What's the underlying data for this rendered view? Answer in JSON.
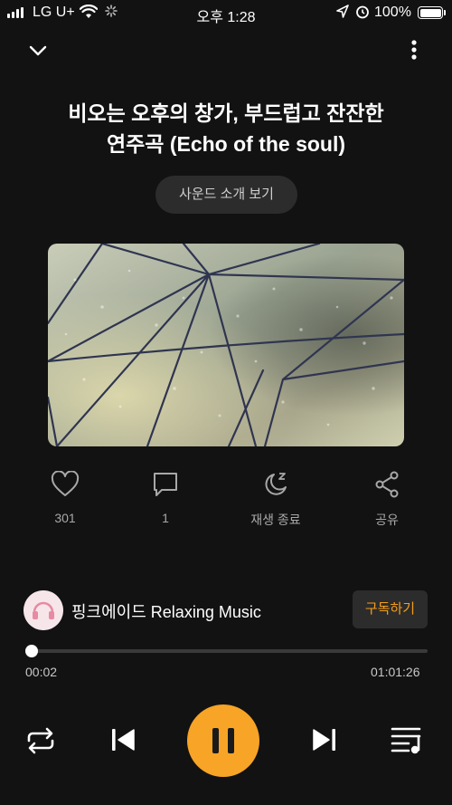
{
  "status_bar": {
    "carrier": "LG U+",
    "time": "오후 1:28",
    "battery_percent": "100%"
  },
  "header": {
    "collapse_icon": "chevron-down-icon",
    "more_icon": "more-vertical-icon"
  },
  "track": {
    "title": "비오는 오후의 창가, 부드럽고 잔잔한\n연주곡 (Echo of the soul)",
    "intro_button": "사운드 소개 보기",
    "artwork": "rainy-umbrella-image"
  },
  "actions": [
    {
      "icon": "heart-icon",
      "label": "301"
    },
    {
      "icon": "comment-icon",
      "label": "1"
    },
    {
      "icon": "sleep-timer-icon",
      "label": "재생 종료"
    },
    {
      "icon": "share-icon",
      "label": "공유"
    }
  ],
  "channel": {
    "name": "핑크에이드 Relaxing Music",
    "subscribe": "구독하기"
  },
  "playback": {
    "current_time": "00:02",
    "total_time": "01:01:26",
    "progress": 0.0005,
    "state": "playing"
  },
  "colors": {
    "background": "#121212",
    "accent": "#f7a427",
    "subscribe_text": "#f59e1b"
  }
}
